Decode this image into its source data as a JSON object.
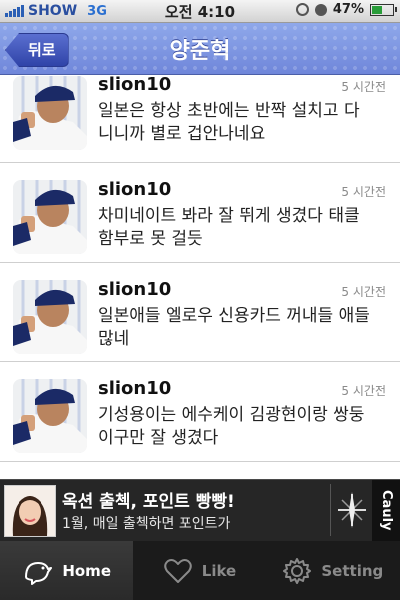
{
  "status_bar": {
    "carrier": "SHOW",
    "network": "3G",
    "time": "오전 4:10",
    "battery": "47%",
    "battery_level": 0.47
  },
  "nav": {
    "back_label": "뒤로",
    "title": "양준혁"
  },
  "feed": {
    "items": [
      {
        "username": "slion10",
        "time": "5 시간전",
        "text": "일본은 항상 초반에는 반짝 설치고 다니니까 별로 겁안나네요"
      },
      {
        "username": "slion10",
        "time": "5 시간전",
        "text": "차미네이트 봐라 잘 뛰게 생겼다 태클 함부로 못 걸듯"
      },
      {
        "username": "slion10",
        "time": "5 시간전",
        "text": "일본애들 엘로우 신용카드 꺼내들 애들 많네"
      },
      {
        "username": "slion10",
        "time": "5 시간전",
        "text": "기성용이는 에수케이 김광현이랑 쌍둥이구만 잘 생겼다"
      }
    ]
  },
  "ad": {
    "title": "옥션 출첵, 포인트 빵빵!",
    "subtitle": "1월, 매일 출첵하면 포인트가",
    "brand": "Cauly"
  },
  "tabs": [
    {
      "label": "Home",
      "icon": "bird-icon",
      "active": true
    },
    {
      "label": "Like",
      "icon": "heart-icon",
      "active": false
    },
    {
      "label": "Setting",
      "icon": "gear-icon",
      "active": false
    }
  ]
}
